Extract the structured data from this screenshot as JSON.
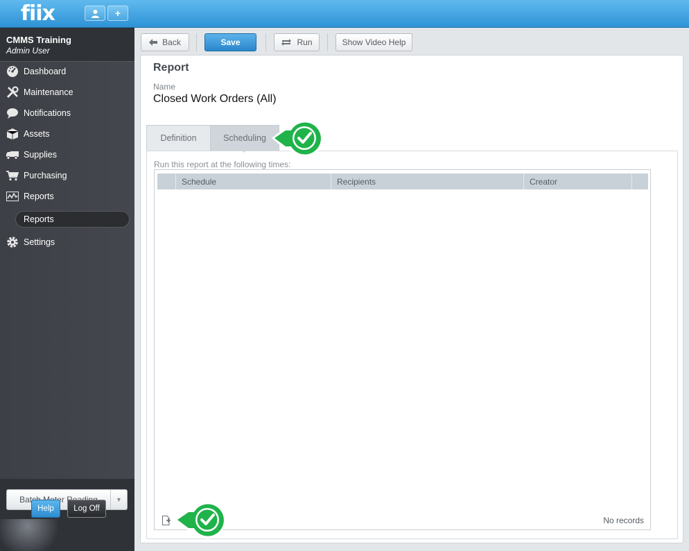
{
  "app": {
    "logo": "fiix"
  },
  "topbar": {
    "user_button_icon": "user-icon",
    "add_button_label": "+"
  },
  "org": {
    "name": "CMMS Training",
    "user": "Admin User"
  },
  "nav": {
    "items": [
      {
        "label": "Dashboard",
        "icon": "dashboard-gauge-icon"
      },
      {
        "label": "Maintenance",
        "icon": "tools-icon"
      },
      {
        "label": "Notifications",
        "icon": "speech-bubble-icon"
      },
      {
        "label": "Assets",
        "icon": "box-icon"
      },
      {
        "label": "Supplies",
        "icon": "truck-icon"
      },
      {
        "label": "Purchasing",
        "icon": "cart-icon"
      },
      {
        "label": "Reports",
        "icon": "chart-icon"
      },
      {
        "label": "Settings",
        "icon": "gear-icon"
      }
    ],
    "sub_item": "Reports"
  },
  "sidebar_bottom": {
    "batch_label": "Batch Meter Reading",
    "help_label": "Help",
    "logoff_label": "Log Off"
  },
  "toolbar": {
    "back_label": "Back",
    "save_label": "Save",
    "run_label": "Run",
    "video_help_label": "Show Video Help"
  },
  "report": {
    "title": "Report",
    "name_label": "Name",
    "name_value": "Closed Work Orders (All)"
  },
  "tabs": [
    {
      "label": "Definition"
    },
    {
      "label": "Scheduling",
      "active": true
    }
  ],
  "scheduling": {
    "instructions": "Run this report at the following times:",
    "columns": [
      "",
      "Schedule",
      "Recipients",
      "Creator",
      ""
    ],
    "rows": [],
    "empty_text": "No records"
  },
  "colors": {
    "accent": "#2a86cc",
    "check_green": "#1fb34a",
    "sidebar": "#3d4046"
  }
}
